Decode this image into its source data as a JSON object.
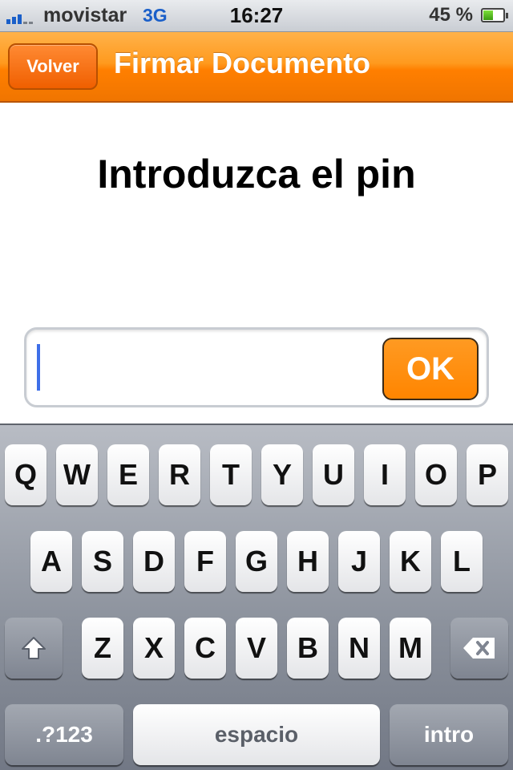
{
  "status_bar": {
    "carrier": "movistar",
    "network": "3G",
    "time": "16:27",
    "battery_percent": "45 %",
    "battery_level": 0.45,
    "signal_bars": 3
  },
  "nav_bar": {
    "back_label": "Volver",
    "title": "Firmar Documento"
  },
  "main": {
    "prompt": "Introduzca el pin",
    "pin_value": "",
    "ok_label": "OK"
  },
  "keyboard": {
    "row1": [
      "Q",
      "W",
      "E",
      "R",
      "T",
      "Y",
      "U",
      "I",
      "O",
      "P"
    ],
    "row2": [
      "A",
      "S",
      "D",
      "F",
      "G",
      "H",
      "J",
      "K",
      "L"
    ],
    "row3": [
      "Z",
      "X",
      "C",
      "V",
      "B",
      "N",
      "M"
    ],
    "numbers_label": ".?123",
    "space_label": "espacio",
    "return_label": "intro",
    "shift_icon": "shift-icon",
    "backspace_icon": "backspace-icon"
  },
  "colors": {
    "accent": "#ff8a00",
    "caret": "#3e6fe8",
    "network": "#1a5fc9"
  }
}
